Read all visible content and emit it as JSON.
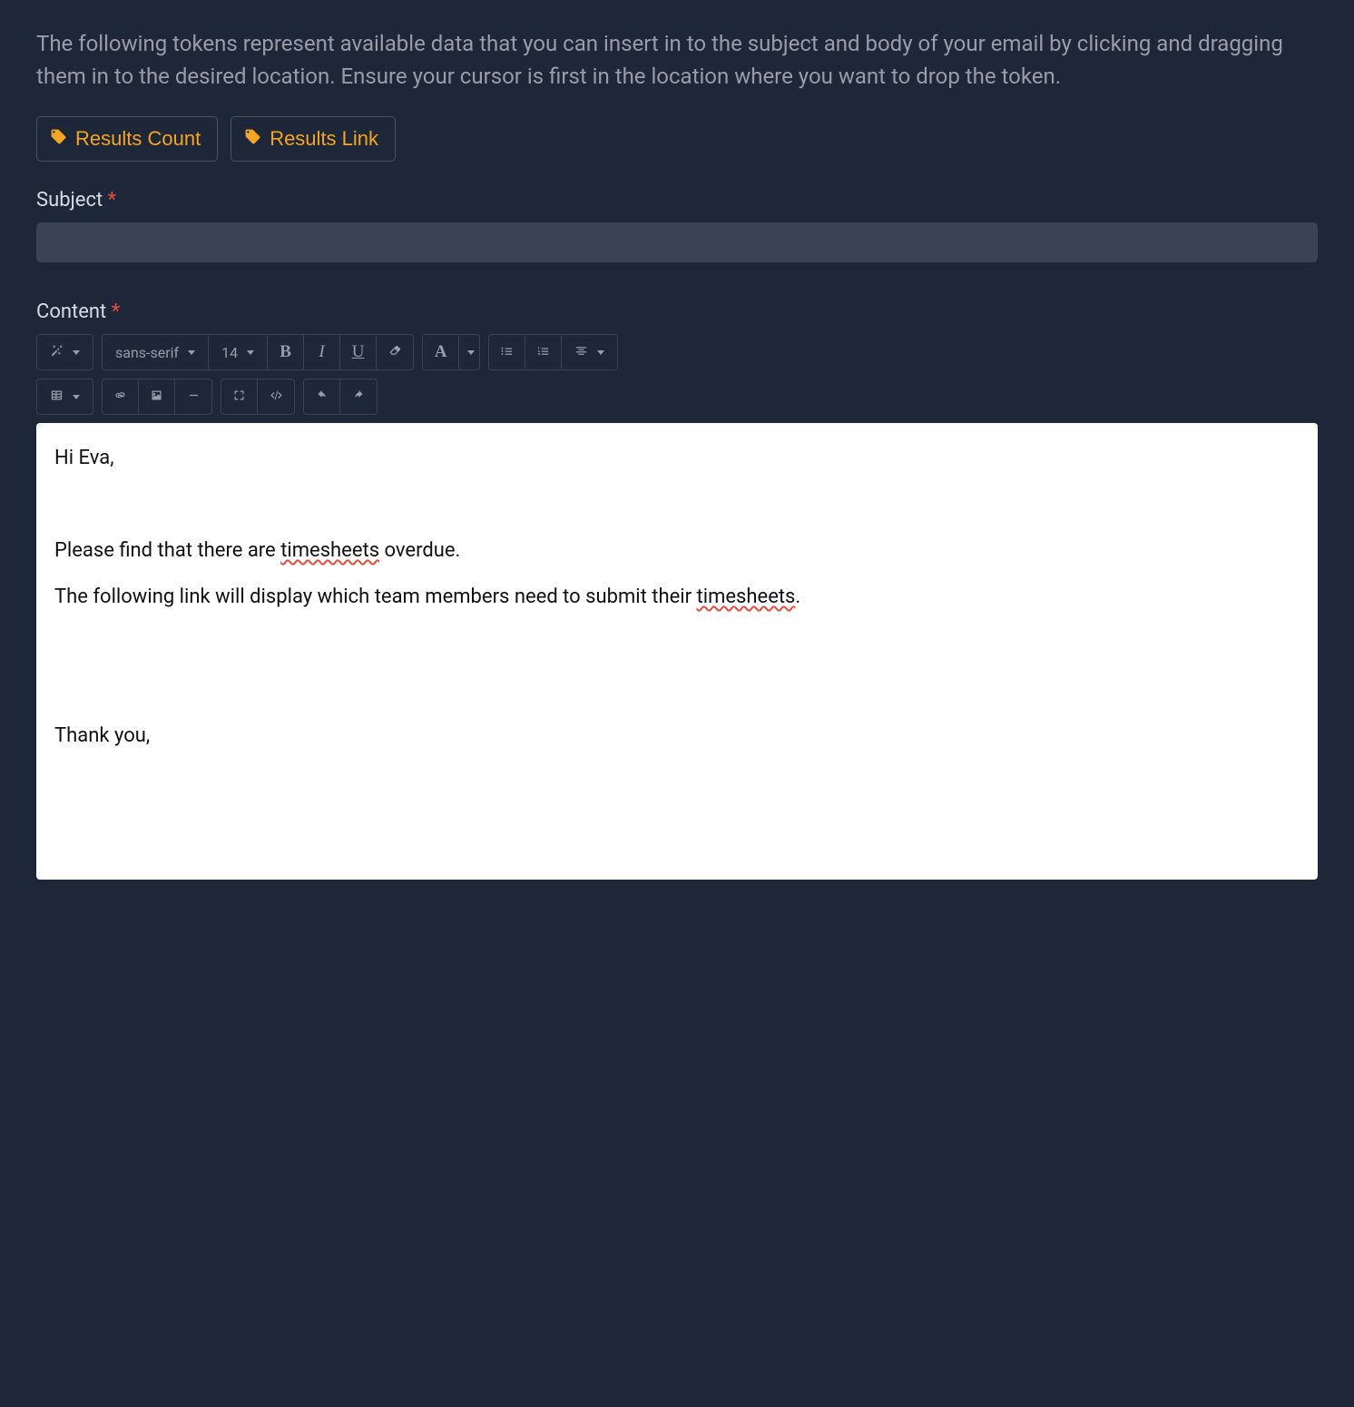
{
  "description": "The following tokens represent available data that you can insert in to the subject and body of your email by clicking and dragging them in to the desired location. Ensure your cursor is first in the location where you want to drop the token.",
  "tokens": {
    "results_count": "Results Count",
    "results_link": "Results Link"
  },
  "labels": {
    "subject": "Subject",
    "content": "Content",
    "required": "*"
  },
  "subject_value": "",
  "toolbar": {
    "font_family": "sans-serif",
    "font_size": "14"
  },
  "content_paragraphs": [
    "Hi Eva,",
    "",
    "Please find that there are  ~timesheets~ overdue.",
    "The following link will display which team members need to submit their ~timesheets~.",
    "",
    "",
    "Thank you,",
    "",
    ""
  ]
}
